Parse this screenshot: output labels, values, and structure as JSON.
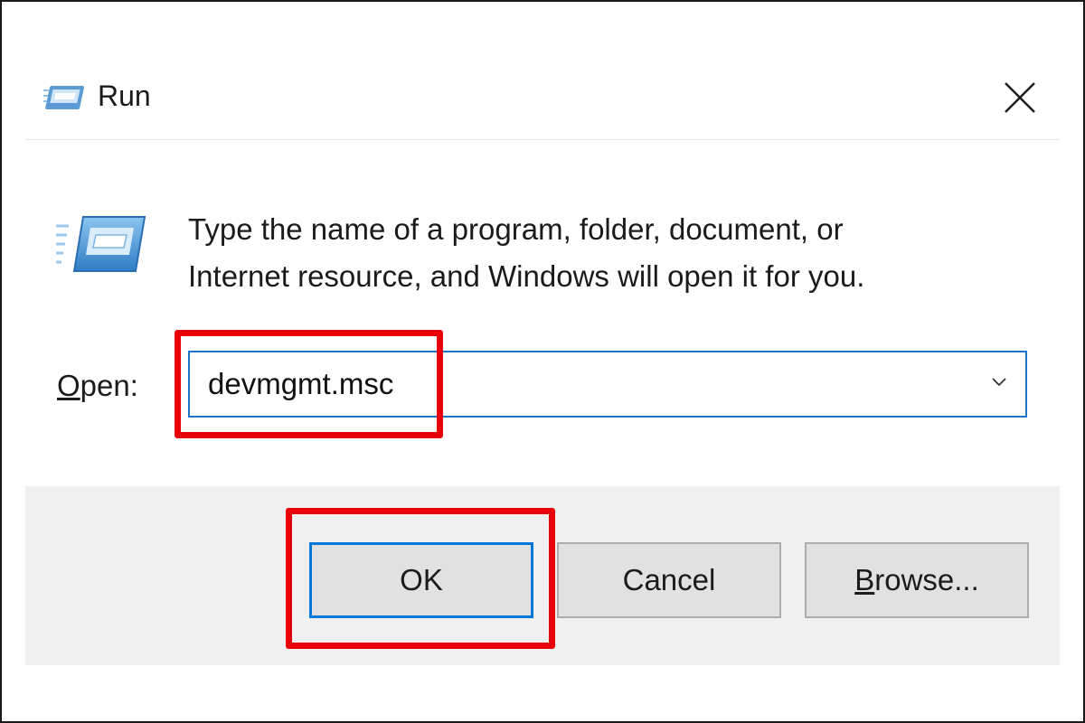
{
  "window": {
    "title": "Run",
    "title_icon": "run-icon",
    "close_icon": "close-icon"
  },
  "main": {
    "icon": "run-icon",
    "description_line1": "Type the name of a program, folder, document, or",
    "description_line2": "Internet resource, and Windows will open it for you.",
    "open_label_accel": "O",
    "open_label_rest": "pen:",
    "open_value": "devmgmt.msc",
    "dropdown_icon": "chevron-down-icon"
  },
  "buttons": {
    "ok_label": "OK",
    "cancel_label": "Cancel",
    "browse_accel": "B",
    "browse_rest": "rowse..."
  },
  "colors": {
    "focus_blue": "#0078d7",
    "highlight_red": "#e8000b",
    "footer_bg": "#f0f0f0"
  }
}
